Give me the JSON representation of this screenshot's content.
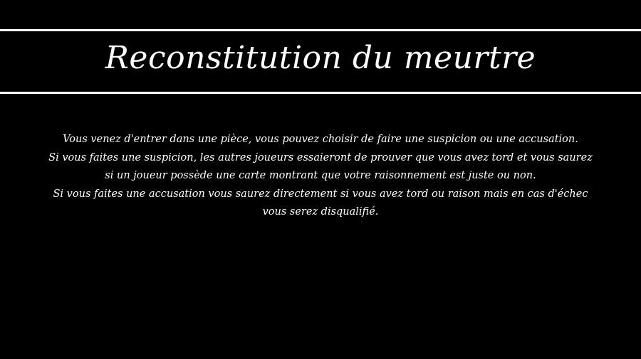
{
  "header": {
    "title": "Reconstitution du meurtre"
  },
  "main": {
    "paragraphs": [
      "Vous venez d'entrer dans une pièce, vous pouvez choisir de faire une suspicion ou une accusation.",
      "Si vous faites une suspicion, les autres joueurs essaieront de prouver que vous avez tord et vous saurez si un joueur possède une carte montrant que votre raisonnement est juste ou non.",
      "Si vous faites une accusation vous saurez directement si vous avez tord ou raison mais en cas d'échec vous serez disqualifié."
    ]
  },
  "colors": {
    "background": "#000000",
    "text": "#ffffff",
    "rules": "#ffffff"
  }
}
